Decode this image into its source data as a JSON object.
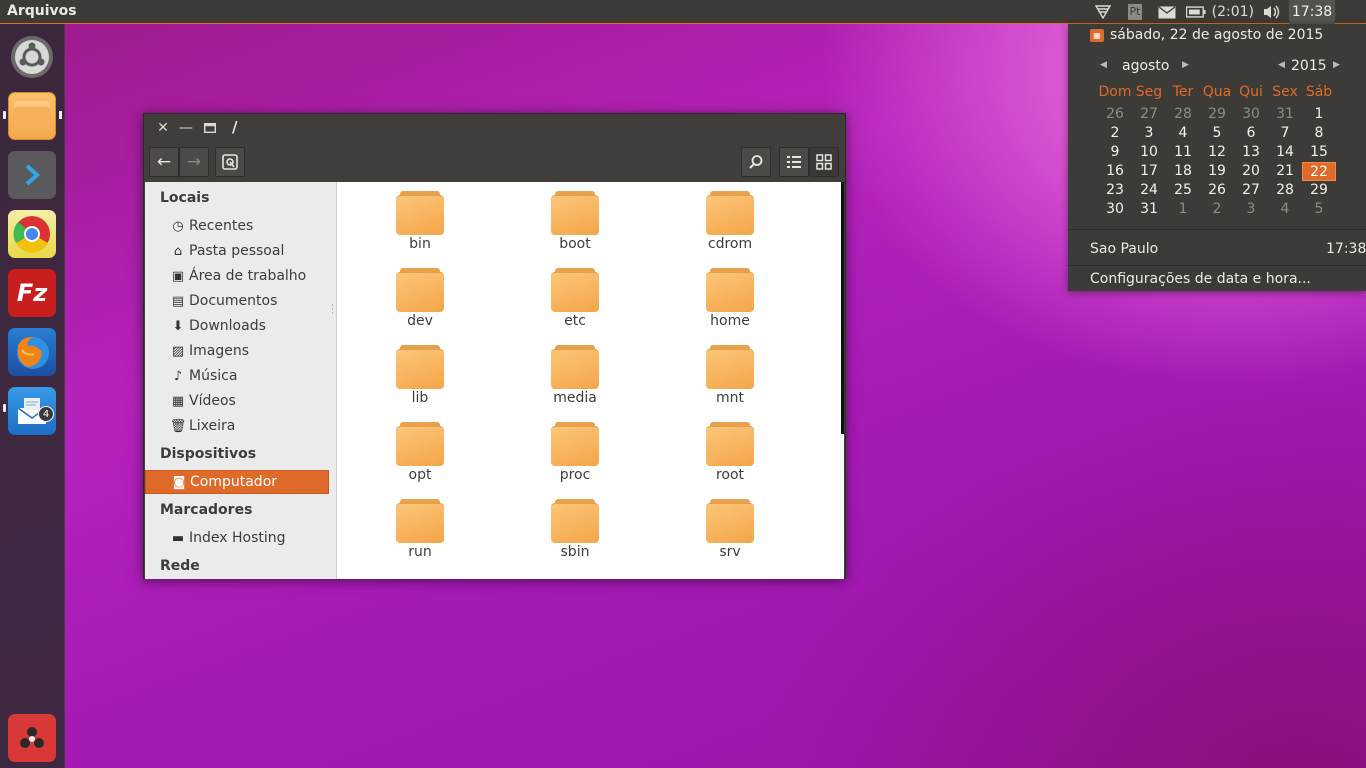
{
  "panel": {
    "app_title": "Arquivos",
    "keyboard_layout": "Pt",
    "battery_text": "(2:01)",
    "clock": "17:38"
  },
  "launcher": {
    "items": [
      {
        "name": "Ubuntu Dash",
        "icon": "ubuntu-logo-icon"
      },
      {
        "name": "Arquivos",
        "icon": "folder-icon"
      },
      {
        "name": "Terminal",
        "icon": "chevron-right-icon"
      },
      {
        "name": "Chrome",
        "icon": "chrome-icon"
      },
      {
        "name": "FileZilla",
        "icon": "filezilla-icon",
        "glyph": "Fz"
      },
      {
        "name": "Firefox",
        "icon": "firefox-icon"
      },
      {
        "name": "Email",
        "icon": "mail-icon"
      },
      {
        "name": "Software",
        "icon": "apps-icon"
      }
    ],
    "mail_badge": "4"
  },
  "window": {
    "path_title": "/",
    "sidebar": {
      "sections": {
        "locais": "Locais",
        "dispositivos": "Dispositivos",
        "marcadores": "Marcadores",
        "rede": "Rede"
      },
      "locais_items": [
        "Recentes",
        "Pasta pessoal",
        "Área de trabalho",
        "Documentos",
        "Downloads",
        "Imagens",
        "Música",
        "Vídeos",
        "Lixeira"
      ],
      "dispositivos_items": [
        "Computador"
      ],
      "marcadores_items": [
        "Index Hosting"
      ]
    },
    "folders": [
      "bin",
      "boot",
      "cdrom",
      "dev",
      "etc",
      "home",
      "lib",
      "media",
      "mnt",
      "opt",
      "proc",
      "root",
      "run",
      "sbin",
      "srv"
    ]
  },
  "calendar": {
    "full_date": "sábado, 22 de agosto de 2015",
    "month": "agosto",
    "year": "2015",
    "weekdays": [
      "Dom",
      "Seg",
      "Ter",
      "Qua",
      "Qui",
      "Sex",
      "Sáb"
    ],
    "weeks": [
      [
        "26",
        "27",
        "28",
        "29",
        "30",
        "31",
        "1"
      ],
      [
        "2",
        "3",
        "4",
        "5",
        "6",
        "7",
        "8"
      ],
      [
        "9",
        "10",
        "11",
        "12",
        "13",
        "14",
        "15"
      ],
      [
        "16",
        "17",
        "18",
        "19",
        "20",
        "21",
        "22"
      ],
      [
        "23",
        "24",
        "25",
        "26",
        "27",
        "28",
        "29"
      ],
      [
        "30",
        "31",
        "1",
        "2",
        "3",
        "4",
        "5"
      ]
    ],
    "today": "22",
    "city": "Sao Paulo",
    "city_time": "17:38",
    "settings_label": "Configurações de data e hora..."
  },
  "colors": {
    "accent": "#e06a2a",
    "panel": "#3c3b37",
    "folder": "#f8b25c"
  }
}
